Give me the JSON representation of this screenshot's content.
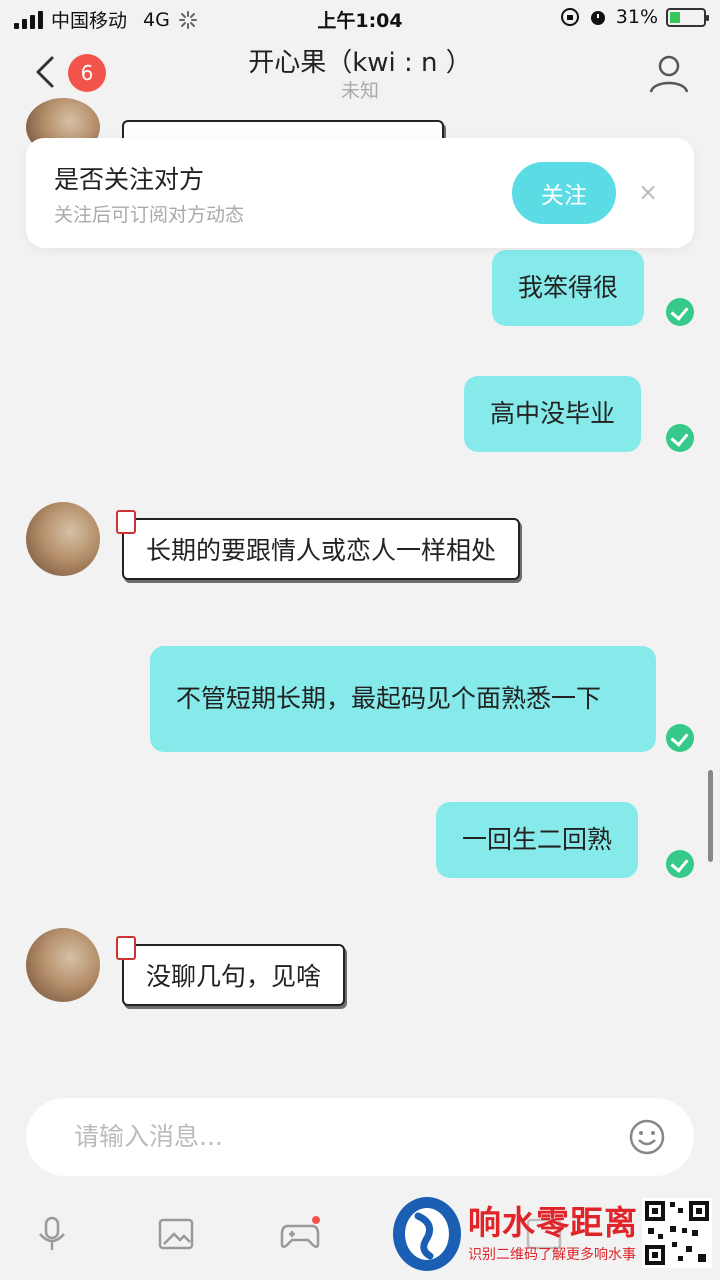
{
  "status_bar": {
    "carrier": "中国移动",
    "network": "4G",
    "time": "上午1:04",
    "battery": "31%",
    "battery_level": 0.31
  },
  "header": {
    "unread_count": "6",
    "title": "开心果（kwi : n ）",
    "subtitle": "未知"
  },
  "follow_card": {
    "title": "是否关注对方",
    "subtitle": "关注后可订阅对方动态",
    "follow_label": "关注",
    "close_label": "×"
  },
  "messages": [
    {
      "from": "me",
      "text": "我笨得很"
    },
    {
      "from": "me",
      "text": "高中没毕业"
    },
    {
      "from": "them",
      "text": "长期的要跟情人或恋人一样相处"
    },
    {
      "from": "me",
      "text": "不管短期长期，最起码见个面熟悉一下"
    },
    {
      "from": "me",
      "text": "一回生二回熟"
    },
    {
      "from": "them",
      "text": "没聊几句，见啥"
    }
  ],
  "input": {
    "placeholder": "请输入消息...",
    "value": ""
  },
  "toolbar": {
    "icons": [
      "microphone-icon",
      "image-icon",
      "game-controller-icon",
      "gif-icon"
    ]
  },
  "watermark": {
    "title": "响水零距离",
    "subtitle": "识别二维码了解更多响水事"
  },
  "colors": {
    "accent": "#5bdce5",
    "outgoing_bubble": "#86eaea",
    "badge": "#f2544b",
    "read_tick": "#35c98a"
  }
}
